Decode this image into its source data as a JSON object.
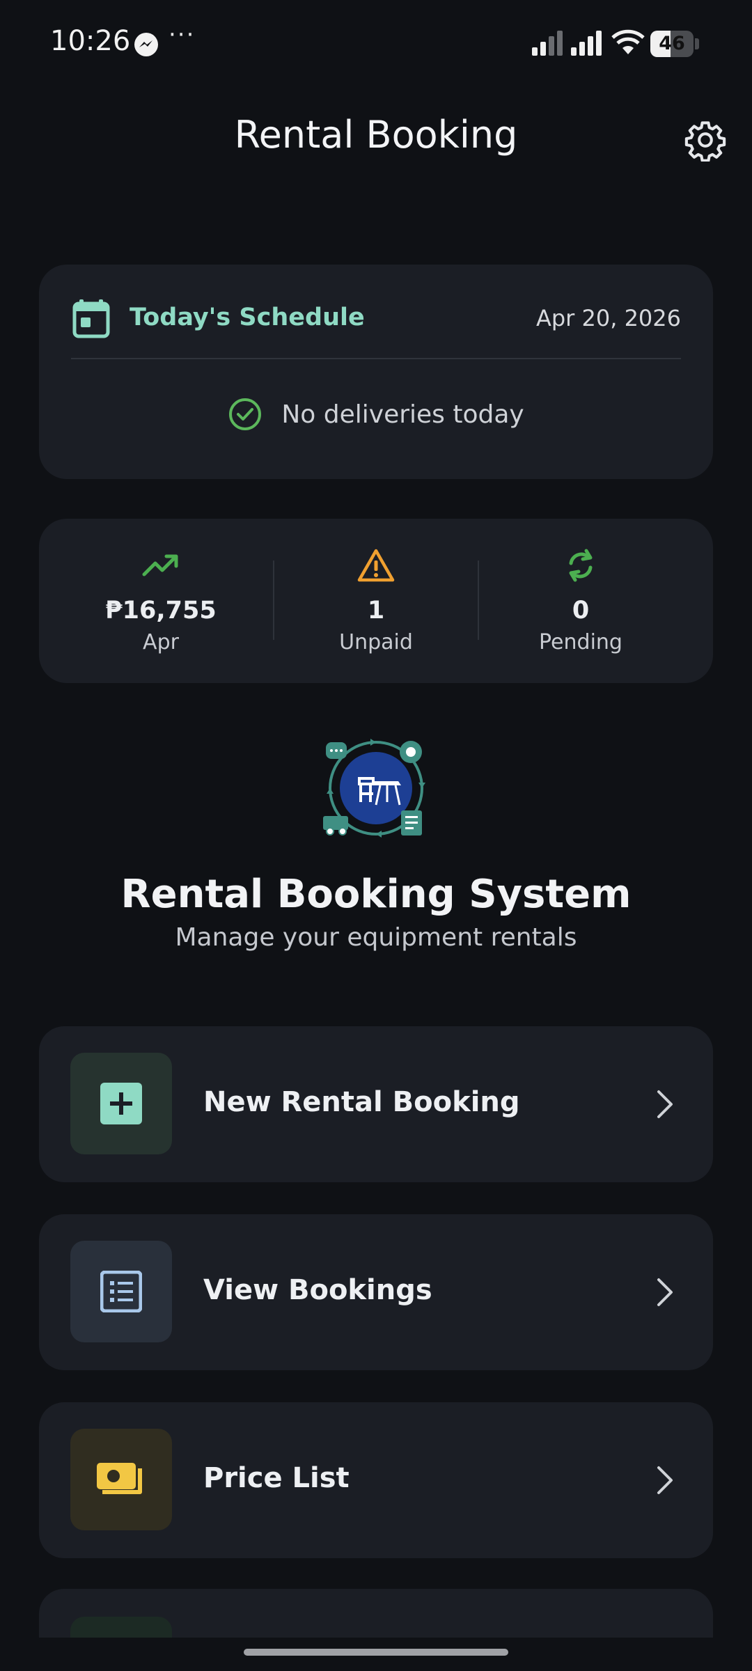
{
  "status_bar": {
    "time": "10:26",
    "battery_level": "46",
    "battery_fraction": 0.46
  },
  "header": {
    "title": "Rental Booking",
    "settings_icon": "gear-icon"
  },
  "schedule": {
    "title": "Today's Schedule",
    "date": "Apr 20, 2026",
    "empty_message": "No deliveries today"
  },
  "stats": [
    {
      "value": "₱16,755",
      "label": "Apr",
      "icon": "trending-up-icon",
      "color": "#4caf50"
    },
    {
      "value": "1",
      "label": "Unpaid",
      "icon": "warning-icon",
      "color": "#f0a030"
    },
    {
      "value": "0",
      "label": "Pending",
      "icon": "sync-icon",
      "color": "#4caf50"
    }
  ],
  "hero": {
    "title": "Rental Booking System",
    "subtitle": "Manage your equipment rentals"
  },
  "menu": [
    {
      "label": "New Rental Booking",
      "icon": "plus-box-icon",
      "accent": "#8fdac4"
    },
    {
      "label": "View Bookings",
      "icon": "list-icon",
      "accent": "#a9c8ea"
    },
    {
      "label": "Price List",
      "icon": "money-icon",
      "accent": "#f2c744"
    }
  ],
  "colors": {
    "background": "#0f1115",
    "card": "#1b1e25",
    "accent_teal": "#8fdac4"
  }
}
